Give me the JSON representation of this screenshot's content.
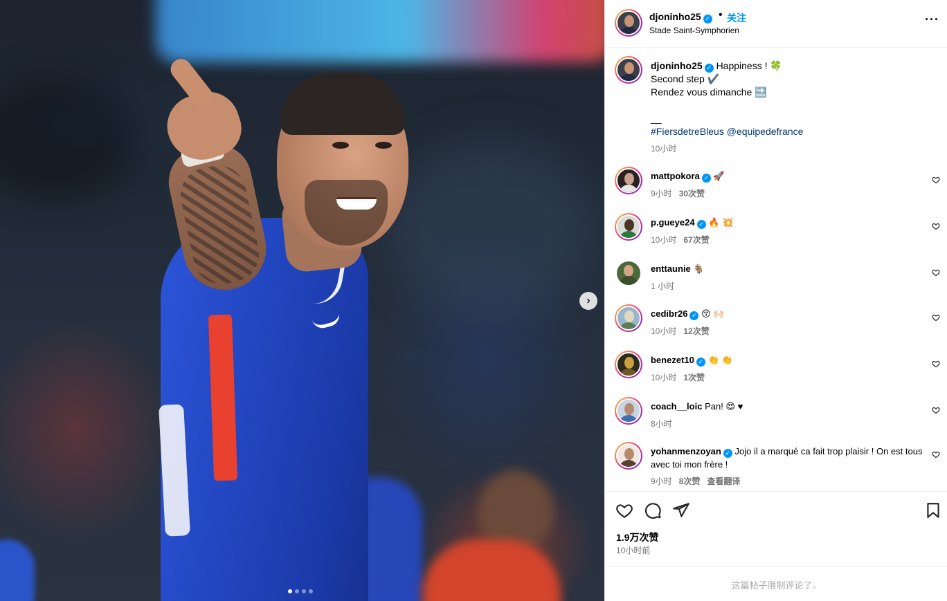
{
  "post": {
    "carousel": {
      "total": 4,
      "active": 0
    }
  },
  "header": {
    "username": "djoninho25",
    "separator": "•",
    "follow_label": "关注",
    "location": "Stade Saint-Symphorien",
    "more_icon": "more-horizontal-icon"
  },
  "caption": {
    "username": "djoninho25",
    "line1": "Happiness ! 🍀",
    "line2": "Second step ✔️",
    "line3": "Rendez vous dimanche 🔜",
    "line4": "__",
    "hashtag": "#FiersdetreBleus",
    "mention": "@equipedefrance",
    "time": "10小时"
  },
  "comments": [
    {
      "username": "mattpokora",
      "text": "🚀",
      "time": "9小时",
      "likes": "30次赞",
      "verified": true
    },
    {
      "username": "p.gueye24",
      "text": "🔥 💥",
      "time": "10小时",
      "likes": "67次赞",
      "verified": true
    },
    {
      "username": "enttaunie",
      "text": "🐐",
      "time": "1 小时",
      "likes": "",
      "verified": false
    },
    {
      "username": "cedibr26",
      "text": "😚 🙌🏻",
      "time": "10小时",
      "likes": "12次赞",
      "verified": true
    },
    {
      "username": "benezet10",
      "text": "👏 👏",
      "time": "10小时",
      "likes": "1次赞",
      "verified": true
    },
    {
      "username": "coach__loic",
      "text": "Pan! 😍 ♥",
      "time": "8小时",
      "likes": "",
      "verified": false
    },
    {
      "username": "yohanmenzoyan",
      "text": "Jojo il a marqué ca fait trop plaisir ! On est tous avec toi mon frère !",
      "time": "9小时",
      "likes": "8次赞",
      "translate": "查看翻译",
      "verified": true
    }
  ],
  "actions": {
    "likes": "1.9万次赞",
    "posted": "10小时前"
  },
  "footer": {
    "notice": "这篇帖子限制评论了。"
  }
}
